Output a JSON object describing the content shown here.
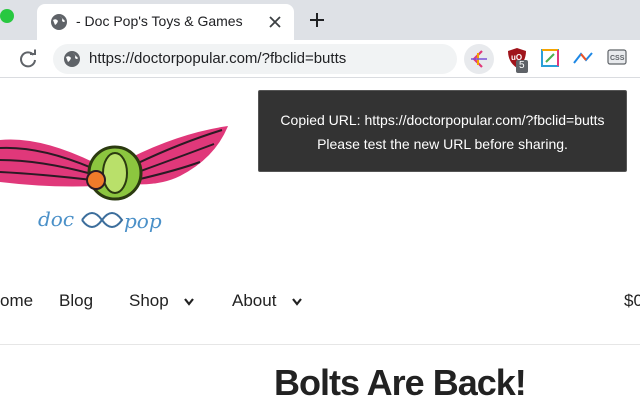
{
  "browser": {
    "tab": {
      "title": "- Doc Pop's Toys & Games"
    },
    "address_bar": {
      "url": "https://doctorpopular.com/?fbclid=butts"
    },
    "extensions": [
      {
        "icon": "url-cleaner-icon",
        "active": true
      },
      {
        "icon": "ublock-icon",
        "badge": "5"
      },
      {
        "icon": "color-picker-icon"
      },
      {
        "icon": "analytics-icon"
      },
      {
        "icon": "css-icon"
      }
    ]
  },
  "toast": {
    "line1": "Copied URL: https://doctorpopular.com/?fbclid=butts",
    "line2": "Please test the new URL before sharing."
  },
  "site": {
    "logo_icon": "winged-yoyo-logo",
    "nav": [
      {
        "label": "ome"
      },
      {
        "label": "Blog"
      },
      {
        "label": "Shop",
        "has_dropdown": true
      },
      {
        "label": "About",
        "has_dropdown": true
      }
    ],
    "cart": "$0",
    "headline": "Bolts Are Back!"
  },
  "colors": {
    "toast_bg": "#333333",
    "tab_strip": "#dee1e6",
    "omnibox": "#f1f3f4",
    "logo_pink": "#e0387a",
    "logo_green": "#8cc63f"
  }
}
